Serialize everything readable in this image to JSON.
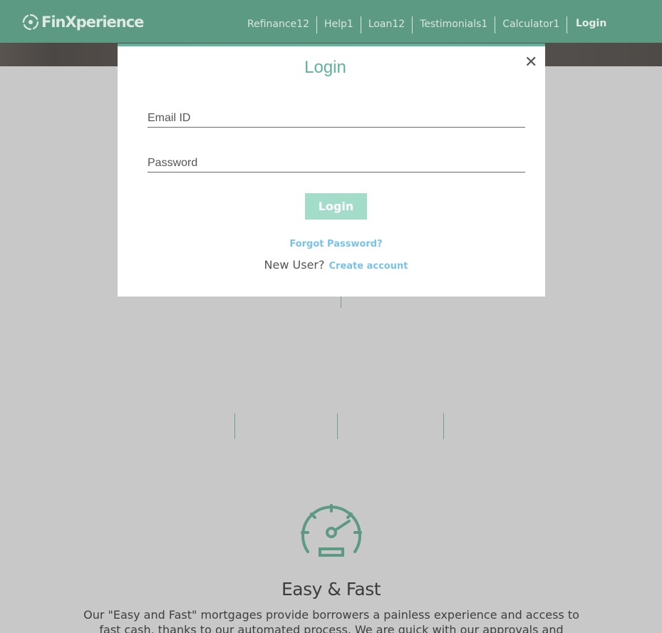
{
  "header": {
    "brand": "FinXperience",
    "nav": [
      "Refinance12",
      "Help1",
      "Loan12",
      "Testimonials1",
      "Calculator1"
    ],
    "login_label": "Login"
  },
  "modal": {
    "title": "Login",
    "close_glyph": "✕",
    "email_placeholder": "Email ID",
    "password_placeholder": "Password",
    "submit_label": "Login",
    "forgot_label": "Forgot Password?",
    "new_user_label": "New User?",
    "create_label": "Create account"
  },
  "feature": {
    "icon": "speedometer-icon",
    "title": "Easy & Fast",
    "description": "Our \"Easy and Fast\" mortgages provide borrowers a painless experience and access to fast cash, thanks to our automated process. We are quick with our approvals and process fast."
  },
  "colors": {
    "header_bg": "#5c9a83",
    "accent": "#5eb39a",
    "button_bg": "#a4dcca",
    "link": "#79c3ea",
    "overlay_bg": "#c8c8c8"
  }
}
